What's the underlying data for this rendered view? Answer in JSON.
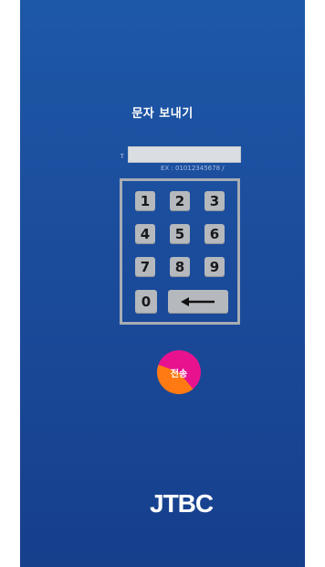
{
  "header": {
    "title": "문자 보내기"
  },
  "phone": {
    "prefix": "T",
    "value": "",
    "hint": "EX : 01012345678 /"
  },
  "keypad": {
    "keys": [
      "1",
      "2",
      "3",
      "4",
      "5",
      "6",
      "7",
      "8",
      "9",
      "0"
    ],
    "backspace_icon": "backspace-arrow-icon"
  },
  "send": {
    "label": "전송",
    "colors": [
      "#e8128f",
      "#ff7a12"
    ]
  },
  "footer": {
    "logo": "JTBC"
  },
  "theme": {
    "background": "#1b4c9c",
    "keypad_border": "#a7adb4",
    "key_fill": "#b5b8bc"
  }
}
